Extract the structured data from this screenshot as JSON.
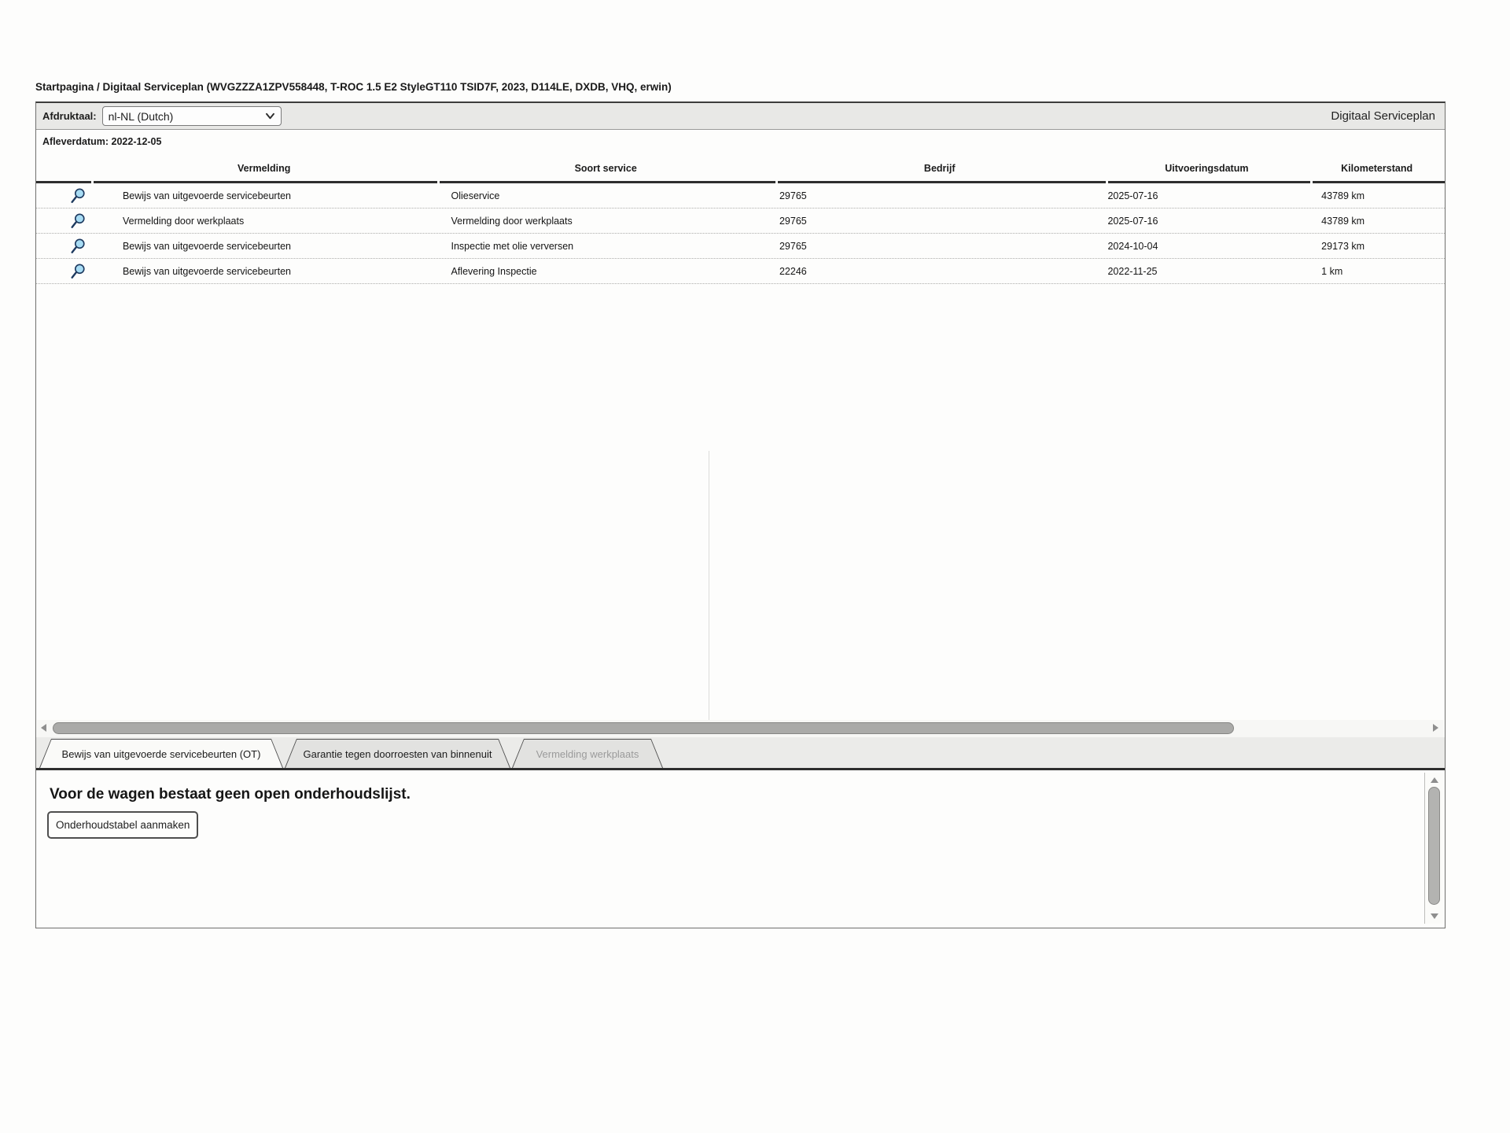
{
  "breadcrumb": "Startpagina / Digitaal Serviceplan (WVGZZZA1ZPV558448, T-ROC 1.5 E2 StyleGT110 TSID7F, 2023, D114LE, DXDB, VHQ, erwin)",
  "header": {
    "app_title": "Digitaal Serviceplan",
    "print_language_label": "Afdruktaal:",
    "print_language_value": "nl-NL (Dutch)",
    "delivery_date": "Afleverdatum: 2022-12-05"
  },
  "service_table": {
    "columns": {
      "vermelding": "Vermelding",
      "soort_service": "Soort service",
      "bedrijf": "Bedrijf",
      "uitvoeringsdatum": "Uitvoeringsdatum",
      "kilometerstand": "Kilometerstand"
    },
    "row_icon": "magnifier-icon",
    "rows": [
      {
        "vermelding": "Bewijs van uitgevoerde servicebeurten",
        "soort_service": "Olieservice",
        "bedrijf": "29765",
        "uitvoeringsdatum": "2025-07-16",
        "kilometerstand": "43789 km"
      },
      {
        "vermelding": "Vermelding door werkplaats",
        "soort_service": "Vermelding door werkplaats",
        "bedrijf": "29765",
        "uitvoeringsdatum": "2025-07-16",
        "kilometerstand": "43789 km"
      },
      {
        "vermelding": "Bewijs van uitgevoerde servicebeurten",
        "soort_service": "Inspectie met olie verversen",
        "bedrijf": "29765",
        "uitvoeringsdatum": "2024-10-04",
        "kilometerstand": "29173 km"
      },
      {
        "vermelding": "Bewijs van uitgevoerde servicebeurten",
        "soort_service": "Aflevering Inspectie",
        "bedrijf": "22246",
        "uitvoeringsdatum": "2022-11-25",
        "kilometerstand": "1 km"
      }
    ]
  },
  "tabs": [
    {
      "label": "Bewijs van uitgevoerde servicebeurten (OT)",
      "state": "active"
    },
    {
      "label": "Garantie tegen doorroesten van binnenuit",
      "state": "normal"
    },
    {
      "label": "Vermelding werkplaats",
      "state": "disabled"
    }
  ],
  "detail_panel": {
    "message": "Voor de wagen bestaat geen open onderhoudslijst.",
    "create_button_label": "Onderhoudstabel aanmaken"
  },
  "colors": {
    "bar_background": "#e8e8e6",
    "tabstrip_background": "#ebebe9",
    "active_tab_background": "#fafaf8",
    "inactive_tab_background": "#e2e2e0",
    "disabled_tab_text": "#9b9b9b",
    "header_underline": "#2e2e2e",
    "magnifier_lens": "#a8dcf4",
    "magnifier_outline": "#1e3a5f",
    "scrollbar_thumb": "#aaaaa8"
  }
}
